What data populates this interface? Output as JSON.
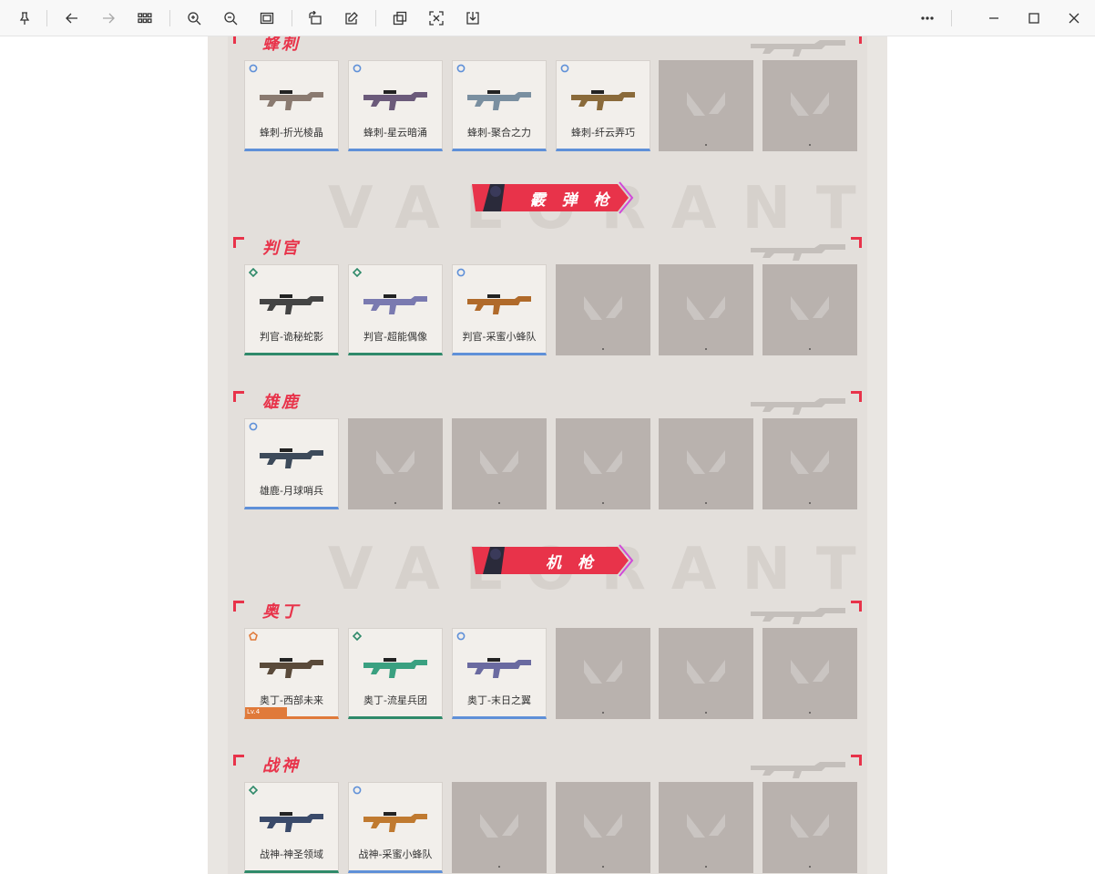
{
  "toolbar": {
    "buttons": [
      {
        "name": "pin-button",
        "icon": "pin-icon"
      },
      {
        "name": "back-button",
        "icon": "arrow-left-icon"
      },
      {
        "name": "forward-button",
        "icon": "arrow-right-icon"
      },
      {
        "name": "gallery-button",
        "icon": "grid-icon"
      },
      {
        "name": "zoom-in-button",
        "icon": "zoom-in-icon"
      },
      {
        "name": "zoom-out-button",
        "icon": "zoom-out-icon"
      },
      {
        "name": "fit-button",
        "icon": "fit-screen-icon"
      },
      {
        "name": "rotate-button",
        "icon": "rotate-icon"
      },
      {
        "name": "edit-button",
        "icon": "edit-icon"
      },
      {
        "name": "copy-button",
        "icon": "copy-icon"
      },
      {
        "name": "extract-text-button",
        "icon": "scan-text-icon"
      },
      {
        "name": "save-button",
        "icon": "download-icon"
      },
      {
        "name": "more-button",
        "icon": "more-icon"
      },
      {
        "name": "minimize-button",
        "icon": "minimize-icon"
      },
      {
        "name": "maximize-button",
        "icon": "maximize-icon"
      },
      {
        "name": "close-button",
        "icon": "close-icon"
      }
    ]
  },
  "poster": {
    "watermark": "VALORANT",
    "colors": {
      "accent": "#e8334a",
      "rare_blue": "#5f90d8",
      "epic_green": "#2f8a6a",
      "exclusive_orange": "#e07a3a",
      "empty_slot": "#b9b2ae"
    },
    "banners": [
      {
        "label": "霰 弹 枪"
      },
      {
        "label": "机 枪"
      }
    ],
    "sections": [
      {
        "title": "蜂刺",
        "items": [
          {
            "name": "蜂刺-折光棱晶",
            "rarity": "blue"
          },
          {
            "name": "蜂刺-星云暗涌",
            "rarity": "blue"
          },
          {
            "name": "蜂刺-聚合之力",
            "rarity": "blue"
          },
          {
            "name": "蜂刺-纤云弄巧",
            "rarity": "blue"
          },
          null,
          null
        ]
      },
      {
        "title": "判官",
        "items": [
          {
            "name": "判官-诡秘蛇影",
            "rarity": "green"
          },
          {
            "name": "判官-超能偶像",
            "rarity": "green"
          },
          {
            "name": "判官-采蜜小蜂队",
            "rarity": "blue"
          },
          null,
          null,
          null
        ]
      },
      {
        "title": "雄鹿",
        "items": [
          {
            "name": "雄鹿-月球哨兵",
            "rarity": "blue"
          },
          null,
          null,
          null,
          null,
          null
        ]
      },
      {
        "title": "奥丁",
        "items": [
          {
            "name": "奥丁-西部未来",
            "rarity": "orange",
            "level": "Lv.4"
          },
          {
            "name": "奥丁-流星兵团",
            "rarity": "green"
          },
          {
            "name": "奥丁-末日之翼",
            "rarity": "blue"
          },
          null,
          null,
          null
        ]
      },
      {
        "title": "战神",
        "items": [
          {
            "name": "战神-神圣领域",
            "rarity": "green"
          },
          {
            "name": "战神-采蜜小蜂队",
            "rarity": "blue"
          },
          null,
          null,
          null,
          null
        ]
      }
    ]
  }
}
